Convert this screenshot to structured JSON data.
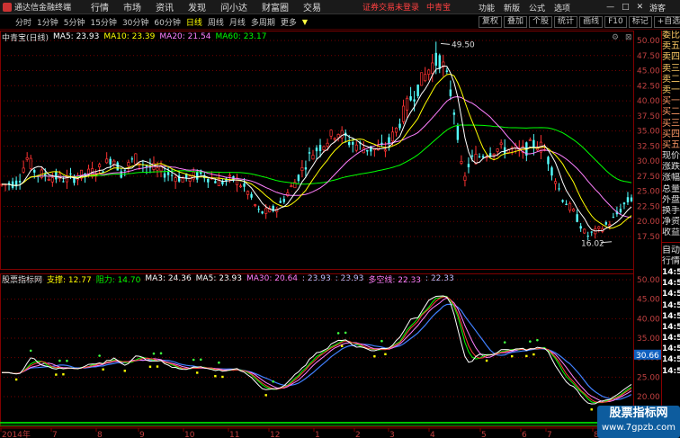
{
  "menubar": {
    "app_title": "通达信金融终端",
    "items": [
      "行情",
      "市场",
      "资讯",
      "发现",
      "问小达",
      "财富圈",
      "交易"
    ],
    "alert": "证券交易未登录",
    "stock": "中青宝",
    "right_items": [
      "功能",
      "新版",
      "公式",
      "选项"
    ],
    "user": "游客"
  },
  "toolbar": {
    "periods": [
      "分时",
      "1分钟",
      "5分钟",
      "15分钟",
      "30分钟",
      "60分钟",
      "日线",
      "周线",
      "月线",
      "多周期",
      "更多"
    ],
    "active_period": "日线",
    "more_arrow": "▼",
    "buttons": [
      "复权",
      "叠加",
      "个股",
      "统计",
      "画线",
      "F10",
      "标记",
      "+自选"
    ]
  },
  "main_indicator": {
    "name": "中青宝(日线)",
    "ma5": "MA5: 23.93",
    "ma10": "MA10: 23.39",
    "ma20": "MA20: 21.54",
    "ma60": "MA60: 23.17"
  },
  "sub_indicator": {
    "name": "股票指标网",
    "support": "支撑: 12.77",
    "resist": "阻力: 14.70",
    "ma3": "MA3: 24.36",
    "ma5": "MA5: 23.93",
    "ma30": "MA30: 20.64",
    "v1": ": 23.93",
    "v2": ": 23.93",
    "multi": "多空线: 22.33",
    "v3": ": 22.33"
  },
  "price_axis": {
    "main_ticks": [
      "50.00",
      "47.50",
      "45.00",
      "42.50",
      "40.00",
      "37.50",
      "35.00",
      "32.50",
      "30.00",
      "27.50",
      "25.00",
      "22.50",
      "20.00",
      "17.50"
    ],
    "sub_ticks": [
      "50.00",
      "45.00",
      "40.00",
      "35.00",
      "30.00",
      "25.00",
      "20.00"
    ],
    "current_tag": "30.66"
  },
  "annotations": {
    "high": "49.50",
    "low": "16.02"
  },
  "date_axis": {
    "labels": [
      "2014年",
      "7",
      "8",
      "9",
      "10",
      "11",
      "12",
      "1",
      "2",
      "3",
      "4",
      "5",
      "6",
      "7",
      "8",
      "9",
      "10",
      "11",
      "12"
    ]
  },
  "right_panel": {
    "items": [
      "委比",
      "卖五",
      "卖四",
      "卖三",
      "卖二",
      "卖一",
      "买一",
      "买二",
      "买三",
      "买四",
      "买五",
      "现价",
      "涨跌",
      "涨幅",
      "总量",
      "外盘",
      "换手",
      "净资",
      "收益"
    ],
    "lower_items": [
      "自动",
      "行情"
    ],
    "times": [
      "14:56",
      "14:56",
      "14:56",
      "14:56",
      "14:56",
      "14:56",
      "14:56",
      "14:56",
      "14:56",
      "14:56"
    ]
  },
  "watermark": {
    "line1": "股票指标网",
    "line2": "www.7gpzb.com"
  },
  "colors": {
    "up": "#ff3232",
    "down": "#54ffff",
    "ma5": "#ffffff",
    "ma10": "#ffff00",
    "ma20": "#ff80ff",
    "ma60": "#00ff00",
    "grid": "#800000"
  },
  "chart_data": {
    "type": "line",
    "title": "中青宝(日线)",
    "xlabel": "",
    "ylabel": "",
    "ylim": [
      16,
      51
    ],
    "x": [
      "2014年",
      "7",
      "8",
      "9",
      "10",
      "11",
      "12",
      "1",
      "2",
      "3",
      "4",
      "5",
      "6",
      "7",
      "8",
      "9",
      "10",
      "11",
      "12"
    ],
    "series": [
      {
        "name": "MA5",
        "values": [
          26,
          27,
          28.5,
          29,
          27.5,
          27.8,
          28,
          26,
          21,
          24,
          33,
          33,
          40,
          45,
          30,
          31,
          34,
          22,
          23.93
        ]
      },
      {
        "name": "MA10",
        "values": [
          26,
          26.8,
          28,
          28.8,
          27.8,
          27.6,
          27.8,
          26.5,
          21.5,
          23.5,
          32,
          32.5,
          39,
          44,
          31.5,
          31,
          33,
          23,
          23.39
        ]
      },
      {
        "name": "MA20",
        "values": [
          25.5,
          26.2,
          27.2,
          28.2,
          28,
          27.5,
          27.6,
          27,
          22.5,
          23,
          30.5,
          32,
          37,
          42,
          33,
          31,
          32,
          24,
          21.54
        ]
      },
      {
        "name": "MA60",
        "values": [
          25.8,
          25.9,
          26.5,
          27,
          27.3,
          27.4,
          27.5,
          27.3,
          25,
          24,
          27,
          30,
          33,
          37,
          36.5,
          34,
          33,
          27,
          23.17
        ]
      }
    ]
  }
}
